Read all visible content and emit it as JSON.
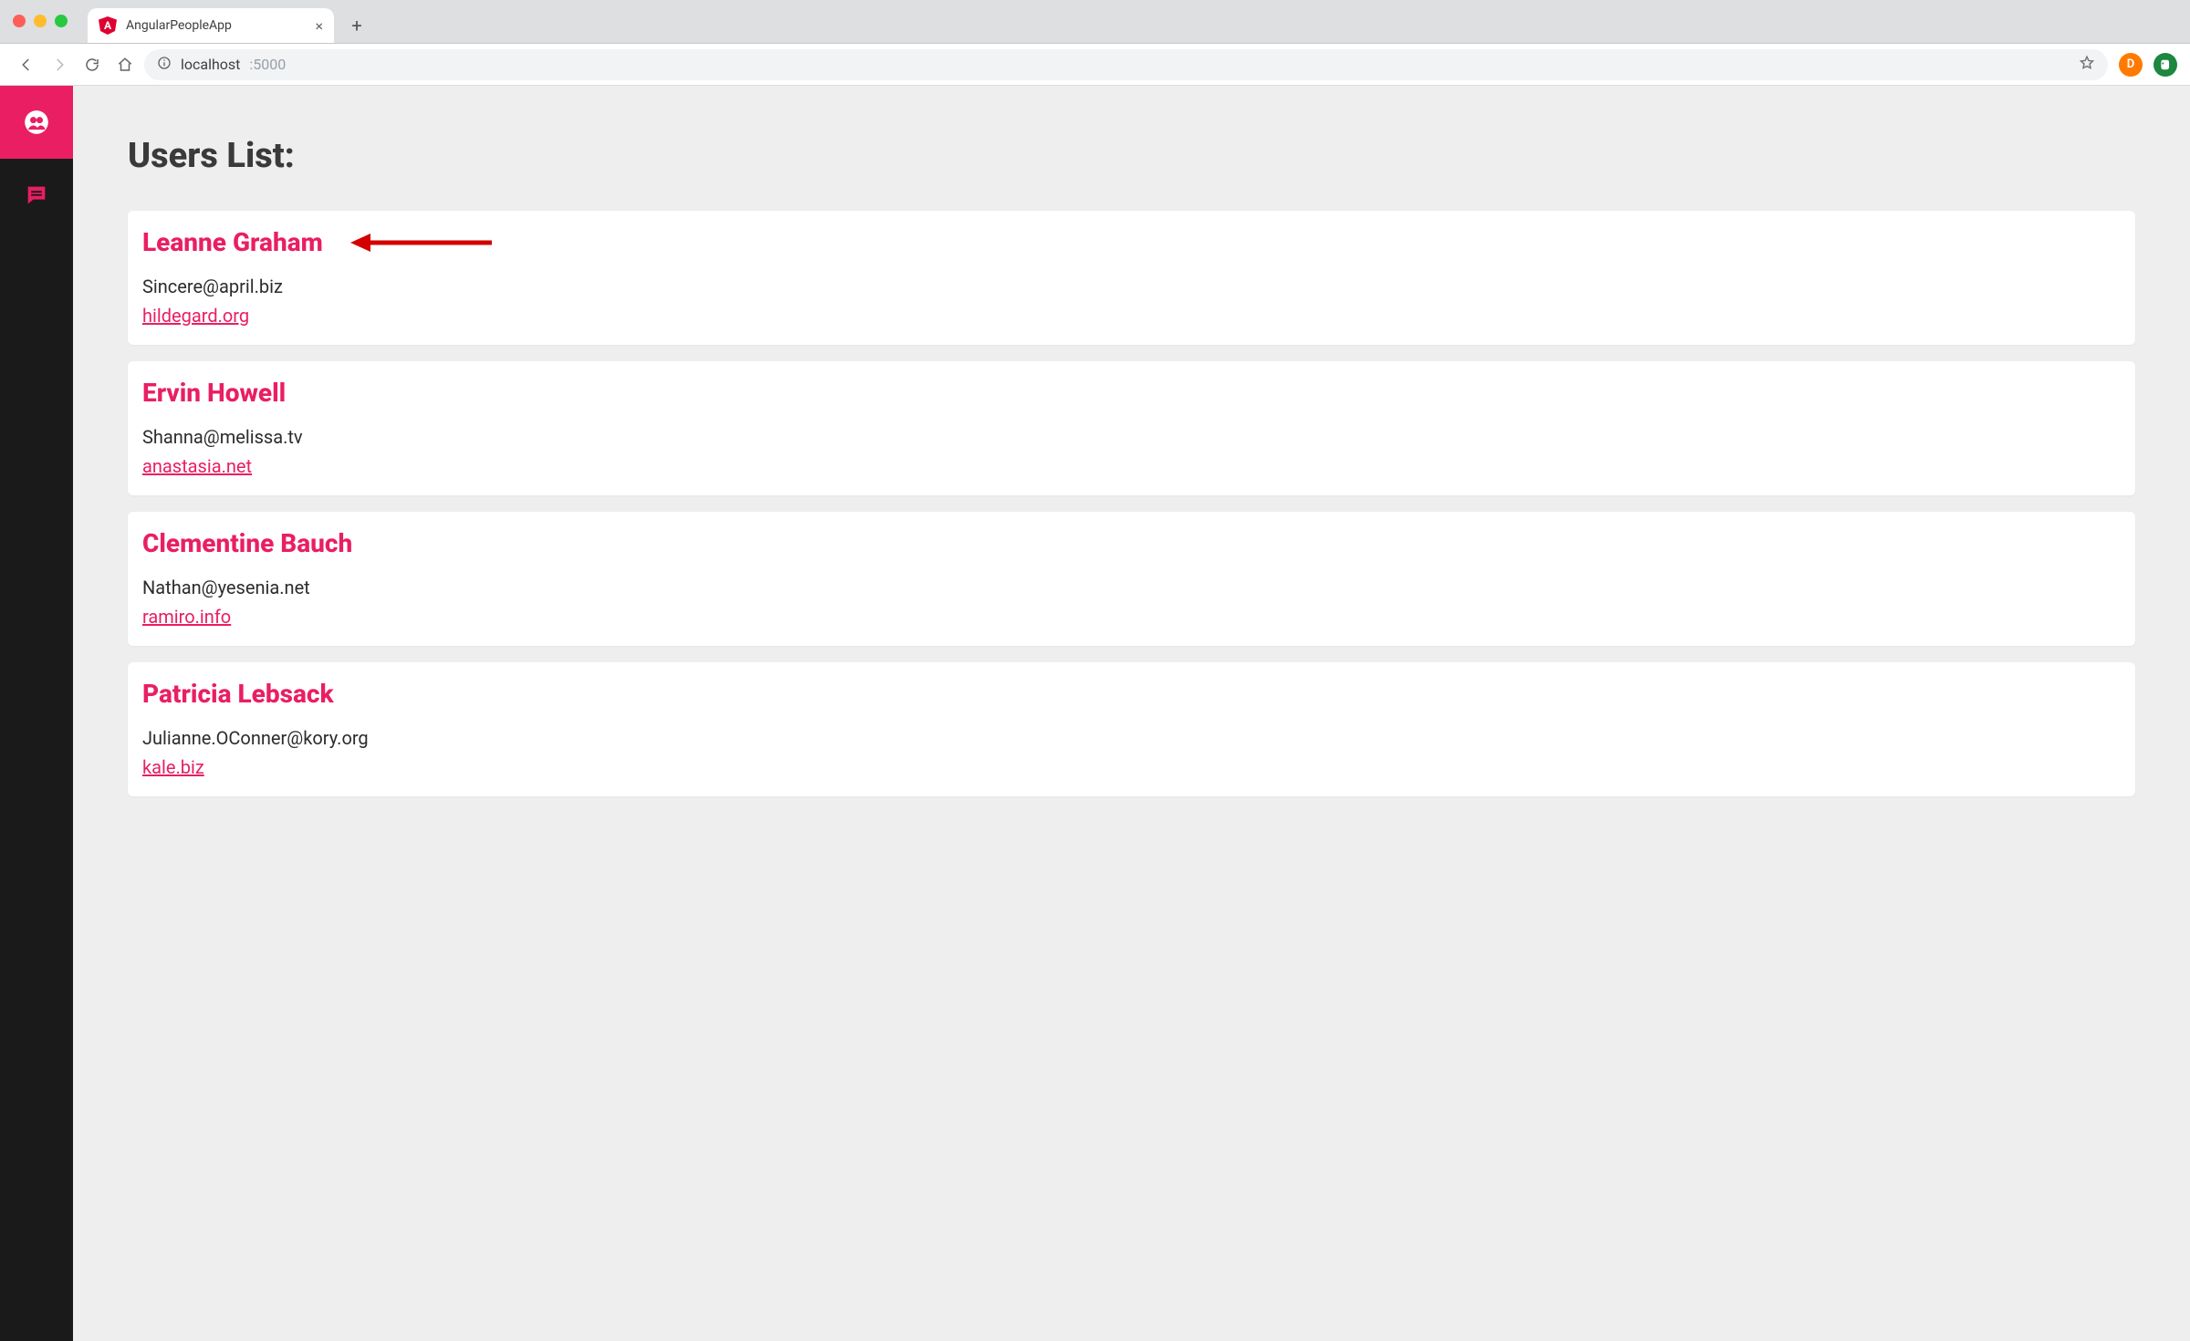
{
  "browser": {
    "tab_title": "AngularPeopleApp",
    "url_host": "localhost",
    "url_port": ":5000",
    "ext_letter": "D"
  },
  "page": {
    "title": "Users List:"
  },
  "users": [
    {
      "name": "Leanne Graham",
      "email": "Sincere@april.biz",
      "website": "hildegard.org"
    },
    {
      "name": "Ervin Howell",
      "email": "Shanna@melissa.tv",
      "website": "anastasia.net"
    },
    {
      "name": "Clementine Bauch",
      "email": "Nathan@yesenia.net",
      "website": "ramiro.info"
    },
    {
      "name": "Patricia Lebsack",
      "email": "Julianne.OConner@kory.org",
      "website": "kale.biz"
    }
  ]
}
